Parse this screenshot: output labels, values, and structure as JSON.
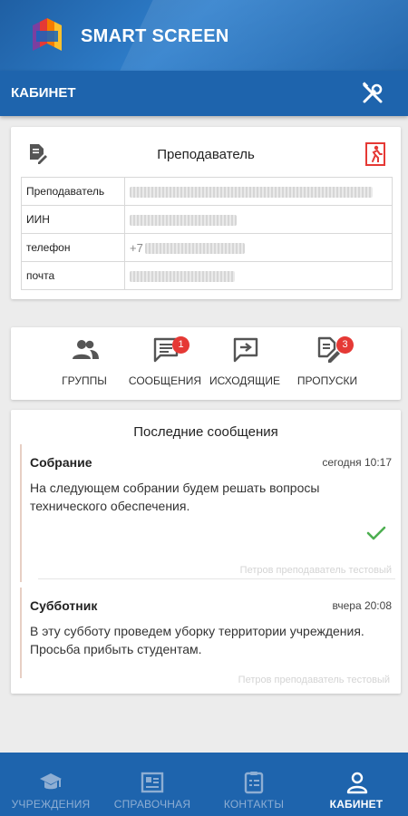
{
  "app": {
    "brand": "SMART SCREEN"
  },
  "header": {
    "title": "КАБИНЕТ"
  },
  "profile": {
    "title": "Преподаватель",
    "rows": [
      {
        "label": "Преподаватель",
        "value": ""
      },
      {
        "label": "ИИН",
        "value": ""
      },
      {
        "label": "телефон",
        "value": "+7"
      },
      {
        "label": "почта",
        "value": ""
      }
    ]
  },
  "actions": [
    {
      "label": "ГРУППЫ",
      "icon": "people-icon",
      "badge": ""
    },
    {
      "label": "СООБЩЕНИЯ",
      "icon": "message-icon",
      "badge": "1"
    },
    {
      "label": "ИСХОДЯЩИЕ",
      "icon": "outbox-icon",
      "badge": ""
    },
    {
      "label": "ПРОПУСКИ",
      "icon": "absence-icon",
      "badge": "3"
    }
  ],
  "messages": {
    "title": "Последние сообщения",
    "items": [
      {
        "subject": "Собрание",
        "time": "сегодня 10:17",
        "body": "На следующем собрании будем решать вопросы технического обеспечения.",
        "author": "Петров преподаватель тестовый",
        "read": true
      },
      {
        "subject": "Субботник",
        "time": "вчера 20:08",
        "body": "В эту субботу проведем уборку территории учреждения. Просьба прибыть студентам.",
        "author": "Петров преподаватель тестовый",
        "read": false
      }
    ]
  },
  "nav": [
    {
      "label": "УЧРЕЖДЕНИЯ",
      "icon": "school-icon",
      "active": false
    },
    {
      "label": "СПРАВОЧНАЯ",
      "icon": "directory-icon",
      "active": false
    },
    {
      "label": "КОНТАКТЫ",
      "icon": "contacts-icon",
      "active": false
    },
    {
      "label": "КАБИНЕТ",
      "icon": "person-icon",
      "active": true
    }
  ],
  "colors": {
    "primary": "#1e64ad",
    "badge": "#e53935",
    "check": "#4caf50",
    "exit": "#e53935"
  }
}
